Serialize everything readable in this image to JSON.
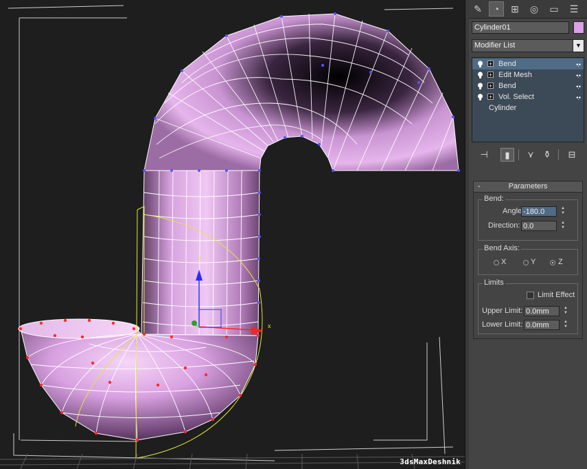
{
  "viewport": {
    "watermark": "3dsMaxDeshnik",
    "gizmo_axes": {
      "z": "z",
      "x": "x"
    },
    "colors": {
      "mesh": "#dca0e6",
      "wire": "#ffffff",
      "gizmo": "#e6e639",
      "selected_verts": "#ff2a2a"
    }
  },
  "command_panel": {
    "tabs": [
      "create-icon",
      "modify-icon",
      "hierarchy-icon",
      "motion-icon",
      "display-icon",
      "utilities-icon"
    ],
    "object_name": "Cylinder01",
    "object_color": "#dca0e6",
    "modifier_list_label": "Modifier List",
    "modifier_list_arrow": "▼",
    "stack": [
      {
        "label": "Bend",
        "selected": true
      },
      {
        "label": "Edit Mesh",
        "selected": false
      },
      {
        "label": "Bend",
        "selected": false
      },
      {
        "label": "Vol. Select",
        "selected": false
      }
    ],
    "stack_base": "Cylinder",
    "stack_dots": "•.•",
    "rollout": {
      "title": "Parameters",
      "collapse": "-",
      "bend_group": "Bend:",
      "angle_label": "Angle:",
      "angle_value": "-180.0",
      "direction_label": "Direction:",
      "direction_value": "0.0",
      "axis_group": "Bend Axis:",
      "axes": [
        {
          "label": "X",
          "checked": false
        },
        {
          "label": "Y",
          "checked": false
        },
        {
          "label": "Z",
          "checked": true
        }
      ],
      "limits_group": "Limits",
      "limit_effect_label": "Limit Effect",
      "limit_effect_checked": false,
      "upper_label": "Upper Limit:",
      "upper_value": "0.0mm",
      "lower_label": "Lower Limit:",
      "lower_value": "0.0mm"
    }
  }
}
